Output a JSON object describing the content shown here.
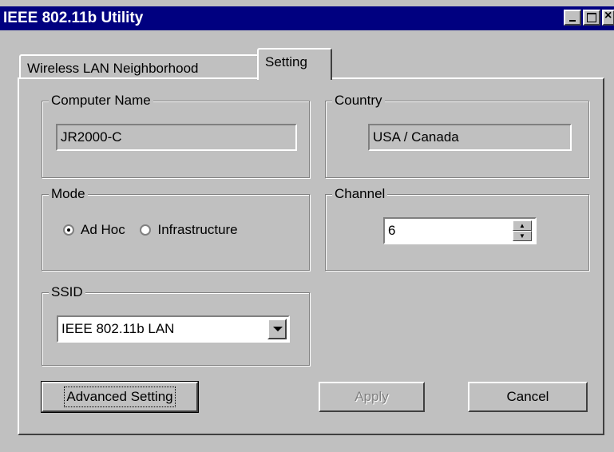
{
  "window": {
    "title": "IEEE 802.11b Utility"
  },
  "tabs": [
    {
      "label": "Wireless LAN Neighborhood",
      "active": false
    },
    {
      "label": "Setting",
      "active": true
    }
  ],
  "computer_name": {
    "label": "Computer Name",
    "value": "JR2000-C"
  },
  "country": {
    "label": "Country",
    "value": "USA / Canada"
  },
  "mode": {
    "label": "Mode",
    "options": [
      {
        "label": "Ad Hoc",
        "selected": true
      },
      {
        "label": "Infrastructure",
        "selected": false
      }
    ]
  },
  "channel": {
    "label": "Channel",
    "value": "6"
  },
  "ssid": {
    "label": "SSID",
    "value": "IEEE 802.11b LAN"
  },
  "buttons": {
    "advanced": "Advanced Setting",
    "apply": "Apply",
    "cancel": "Cancel"
  },
  "colors": {
    "titlebar": "#000080",
    "face": "#c0c0c0"
  }
}
